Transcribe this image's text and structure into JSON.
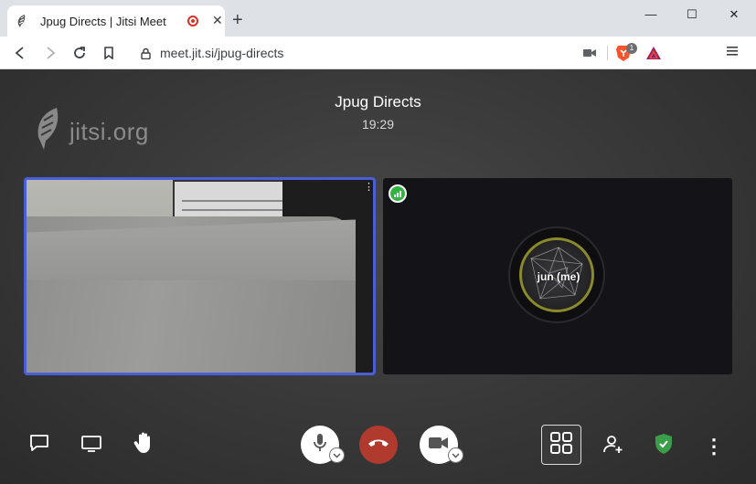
{
  "browser": {
    "tab_title": "Jpug Directs | Jitsi Meet",
    "tab_close": "✕",
    "new_tab": "+",
    "window_minimize": "—",
    "window_maximize": "☐",
    "window_close": "✕",
    "url": "meet.jit.si/jpug-directs",
    "brave_badge_count": "1"
  },
  "meeting": {
    "watermark": "jitsi.org",
    "conference_name": "Jpug Directs",
    "timer": "19:29",
    "remote_participant_name": "jun (me)",
    "local_tile_menu": "⋮"
  },
  "toolbar": {
    "more_label": "⋮"
  },
  "colors": {
    "active_speaker_border": "#4a5fd6",
    "hangup": "#b03a2e",
    "signal_good": "#31b342",
    "security_shield": "#3a9d4a"
  },
  "icons": [
    "chat-icon",
    "screen-share-icon",
    "raise-hand-icon",
    "microphone-icon",
    "hangup-icon",
    "camera-icon",
    "tile-view-icon",
    "invite-icon",
    "security-shield-icon",
    "more-icon"
  ]
}
